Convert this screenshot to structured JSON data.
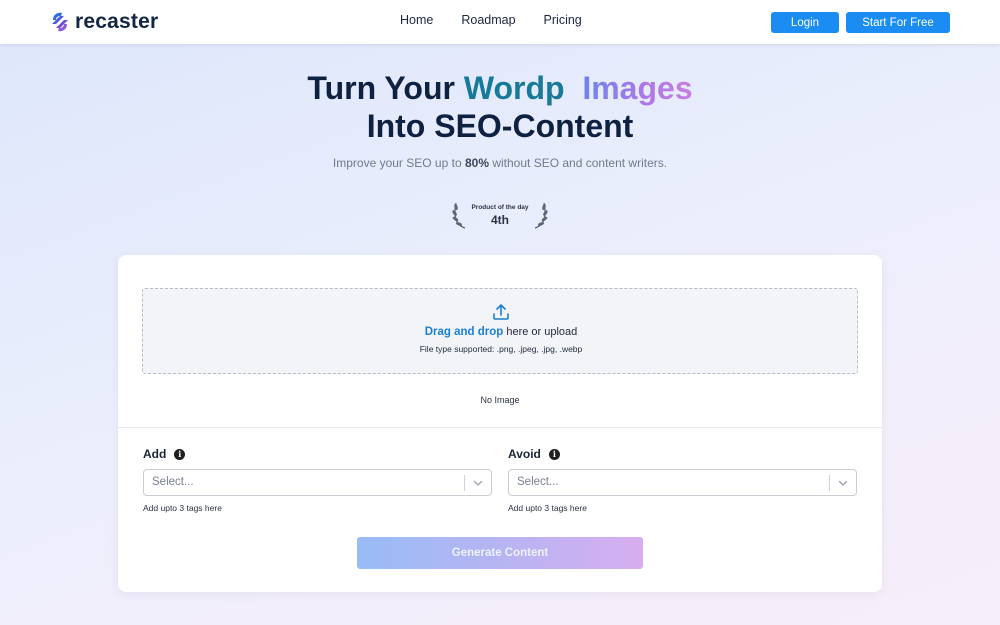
{
  "brand": {
    "name": "recaster",
    "logo_icon": "recaster-swirl-icon"
  },
  "nav": {
    "items": [
      "Home",
      "Roadmap",
      "Pricing"
    ]
  },
  "auth": {
    "login_label": "Login",
    "start_label": "Start For Free"
  },
  "hero": {
    "title_prefix": "Turn Your",
    "rotating_word_1": "Wordp",
    "rotating_word_2": "Images",
    "title_line2": "Into SEO-Content",
    "subtitle_before": "Improve your SEO up to",
    "subtitle_highlight": "80%",
    "subtitle_after": "without SEO and content writers."
  },
  "award": {
    "label": "Product of the day",
    "rank": "4th"
  },
  "upload": {
    "link_text": "Drag and drop",
    "rest_text": "here or upload",
    "file_types": "File type supported: .png, .jpeg, .jpg, .webp",
    "empty_state": "No Image"
  },
  "fields": {
    "add": {
      "label": "Add",
      "placeholder": "Select...",
      "hint": "Add upto 3 tags here"
    },
    "avoid": {
      "label": "Avoid",
      "placeholder": "Select...",
      "hint": "Add upto 3 tags here"
    }
  },
  "generate_label": "Generate Content",
  "colors": {
    "primary_button": "#1a8cf2",
    "rotating_word_1": "#177a98",
    "heading": "#0e2140"
  }
}
